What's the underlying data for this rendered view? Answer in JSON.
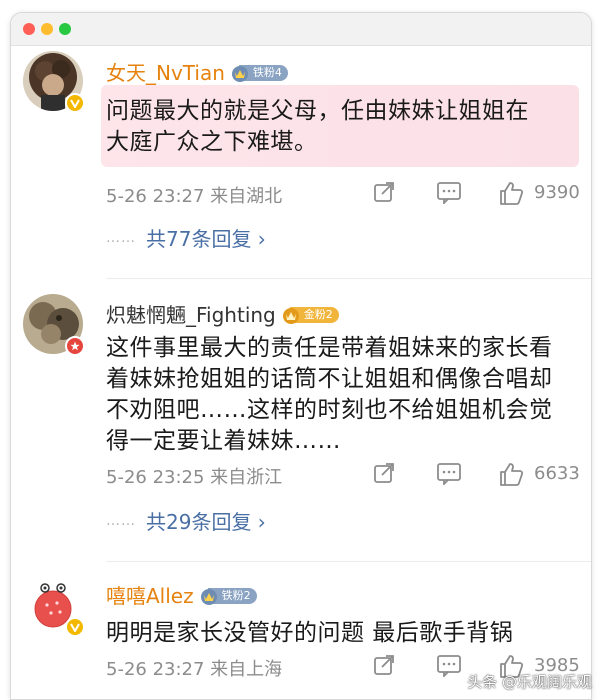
{
  "window": {
    "controls": [
      "close",
      "minimize",
      "maximize"
    ]
  },
  "comments": [
    {
      "username": "女天_NvTian",
      "fan_badge": "铁粉4",
      "text_lines": [
        "问题最大的就是父母，任由妹妹让姐姐在",
        "大庭广众之下难堪。"
      ],
      "time": "5-26 23:27 来自湖北",
      "likes": "9390",
      "replies": "共77条回复 ›"
    },
    {
      "username": "炽魅惘魎_Fighting",
      "fan_badge": "金粉2",
      "text_lines": [
        "这件事里最大的责任是带着姐妹来的家长看",
        "着妹妹抢姐姐的话筒不让姐姐和偶像合唱却",
        "不劝阻吧……这样的时刻也不给姐姐机会觉",
        "得一定要让着妹妹……"
      ],
      "time": "5-26 23:25 来自浙江",
      "likes": "6633",
      "replies": "共29条回复 ›"
    },
    {
      "username": "嘻嘻Allez",
      "fan_badge": "铁粉2",
      "text_lines": [
        "明明是家长没管好的问题 最后歌手背锅"
      ],
      "time": "5-26 23:27 来自上海",
      "likes": "3985"
    }
  ],
  "watermark": "头条 @乐观阔乐观",
  "colors": {
    "username_orange": "#e6820e",
    "reply_link": "#4a6fa5",
    "meta_gray": "#8c8c8c",
    "highlight": "#fde5ea"
  }
}
